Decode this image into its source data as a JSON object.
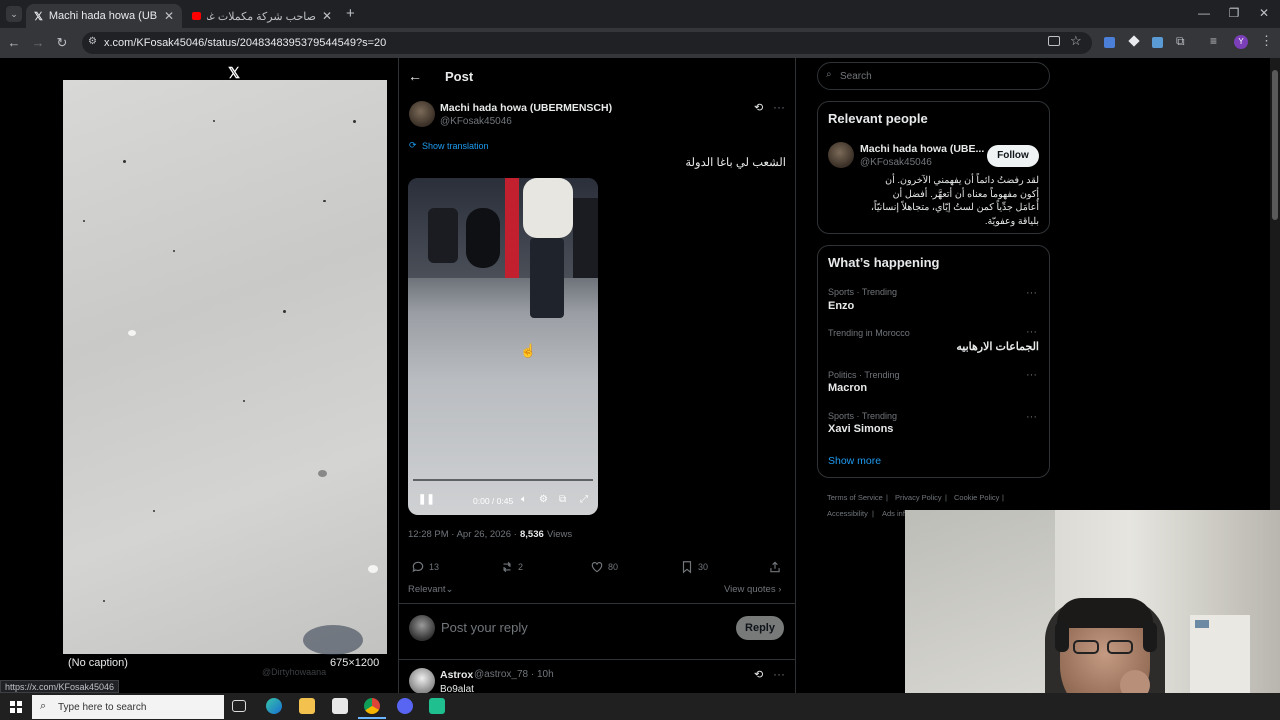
{
  "browser": {
    "tabs": [
      {
        "label": "Machi hada howa (UBERMENSC",
        "active": true
      },
      {
        "label": "صاحب شركة مكملات غذائية يواج",
        "active": false
      }
    ],
    "new_tab": "+",
    "url": "x.com/KFosak45046/status/2048348395379544549?s=20",
    "hover_url": "https://x.com/KFosak45046",
    "tab_close": "✕"
  },
  "media_viewer": {
    "caption": "(No caption)",
    "dimensions": "675×1200",
    "behind_text": "@Dirtyhowaana"
  },
  "post": {
    "header_title": "Post",
    "author_name": "Machi hada howa (UBERMENSCH)",
    "author_handle": "@KFosak45046",
    "show_translation": "Show translation",
    "text": "الشعب لي باغا الدولة",
    "video_time": "0:00 / 0:45",
    "timestamp": "12:28 PM · Apr 26, 2026 ·",
    "views_count": "8,536",
    "views_label": "Views",
    "replies": "13",
    "reposts": "2",
    "likes": "80",
    "bookmarks": "30",
    "sort_label": "Relevant",
    "view_quotes": "View quotes",
    "reply_placeholder": "Post your reply",
    "reply_button": "Reply"
  },
  "first_reply": {
    "name": "Astrox",
    "handle": "@astrox_78 · 10h",
    "text": "Bo9alat"
  },
  "sidebar": {
    "search_placeholder": "Search",
    "relevant_people": {
      "title": "Relevant people",
      "name": "Machi hada howa (UBE...",
      "handle": "@KFosak45046",
      "follow": "Follow",
      "bio_lines": [
        "لقد رفضتُ دائماً أن يفهمني الآخرون. أن",
        "أكون مفهوماً معناه أن أتعهَّر. أفضل أن",
        "أُعامَل جدِّياً كمن لستُ إيّاي، متجاهلاً إنسانيّاً،",
        "بلياقة وعفويّة."
      ]
    },
    "whats_happening": {
      "title": "What’s happening",
      "trends": [
        {
          "meta": "Sports · Trending",
          "name": "Enzo"
        },
        {
          "meta": "Trending in Morocco",
          "name": "الجماعات الارهابيه"
        },
        {
          "meta": "Politics · Trending",
          "name": "Macron"
        },
        {
          "meta": "Sports · Trending",
          "name": "Xavi Simons"
        }
      ],
      "show_more": "Show more"
    },
    "footer": [
      "Terms of Service",
      "Privacy Policy",
      "Cookie Policy",
      "Accessibility",
      "Ads info"
    ]
  },
  "taskbar": {
    "search_placeholder": "Type here to search"
  }
}
